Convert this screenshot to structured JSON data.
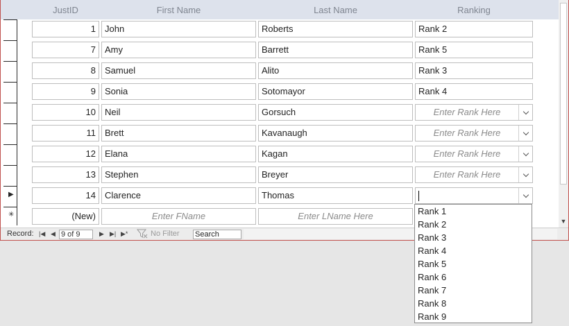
{
  "headers": {
    "id": "JustID",
    "first": "First Name",
    "last": "Last Name",
    "ranking": "Ranking"
  },
  "rows": [
    {
      "id": "1",
      "first": "John",
      "last": "Roberts",
      "ranking": "Rank 2"
    },
    {
      "id": "7",
      "first": "Amy",
      "last": "Barrett",
      "ranking": "Rank 5"
    },
    {
      "id": "8",
      "first": "Samuel",
      "last": "Alito",
      "ranking": "Rank 3"
    },
    {
      "id": "9",
      "first": "Sonia",
      "last": "Sotomayor",
      "ranking": "Rank 4"
    },
    {
      "id": "10",
      "first": "Neil",
      "last": "Gorsuch",
      "ranking": ""
    },
    {
      "id": "11",
      "first": "Brett",
      "last": "Kavanaugh",
      "ranking": ""
    },
    {
      "id": "12",
      "first": "Elana",
      "last": "Kagan",
      "ranking": ""
    },
    {
      "id": "13",
      "first": "Stephen",
      "last": "Breyer",
      "ranking": ""
    },
    {
      "id": "14",
      "first": "Clarence",
      "last": "Thomas",
      "ranking": ""
    }
  ],
  "placeholders": {
    "ranking": "Enter Rank Here",
    "first": "Enter FName",
    "last": "Enter LName Here"
  },
  "new_row": {
    "id": "(New)"
  },
  "current_row_index": 8,
  "dropdown_options": [
    "Rank 1",
    "Rank 2",
    "Rank 3",
    "Rank 4",
    "Rank 5",
    "Rank 6",
    "Rank 7",
    "Rank 8",
    "Rank 9"
  ],
  "navigation": {
    "record_label": "Record:",
    "record_position": "9 of 9",
    "first_glyph": "|◀",
    "prev_glyph": "◀",
    "next_glyph": "▶",
    "last_glyph": "▶|",
    "new_glyph": "▶*",
    "filter_label": "No Filter",
    "search_text": "Search"
  },
  "colors": {
    "header_bg": "#dde2ec",
    "form_border": "#c0504d",
    "placeholder": "#8a8a8a"
  }
}
